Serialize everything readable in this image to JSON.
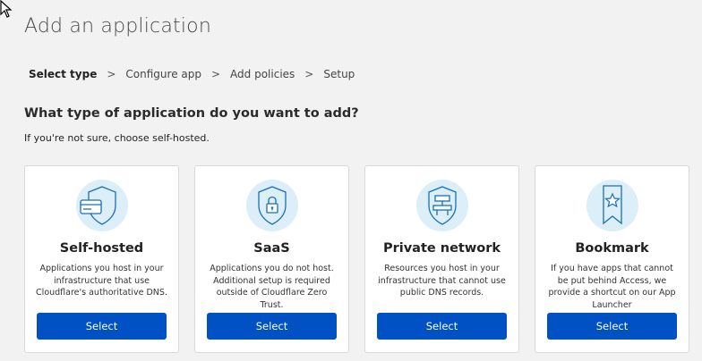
{
  "page": {
    "title": "Add an application"
  },
  "breadcrumb": {
    "steps": [
      "Select type",
      "Configure app",
      "Add policies",
      "Setup"
    ],
    "separator": ">"
  },
  "question": "What type of application do you want to add?",
  "hint": "If you're not sure, choose self-hosted.",
  "colors": {
    "accent": "#0051c3",
    "icon_bg": "#dceef8",
    "icon_stroke": "#1a6fb8"
  },
  "cards": [
    {
      "icon": "shield-card-icon",
      "title": "Self-hosted",
      "description": "Applications you host in your infrastructure that use Cloudflare's authoritative DNS.",
      "button": "Select"
    },
    {
      "icon": "shield-lock-icon",
      "title": "SaaS",
      "description": "Applications you do not host. Additional setup is required outside of Cloudflare Zero Trust.",
      "button": "Select"
    },
    {
      "icon": "shield-network-icon",
      "title": "Private network",
      "description": "Resources you host in your infrastructure that cannot use public DNS records.",
      "button": "Select"
    },
    {
      "icon": "bookmark-star-icon",
      "title": "Bookmark",
      "description": "If you have apps that cannot be put behind Access, we provide a shortcut on our App Launcher",
      "button": "Select"
    }
  ]
}
